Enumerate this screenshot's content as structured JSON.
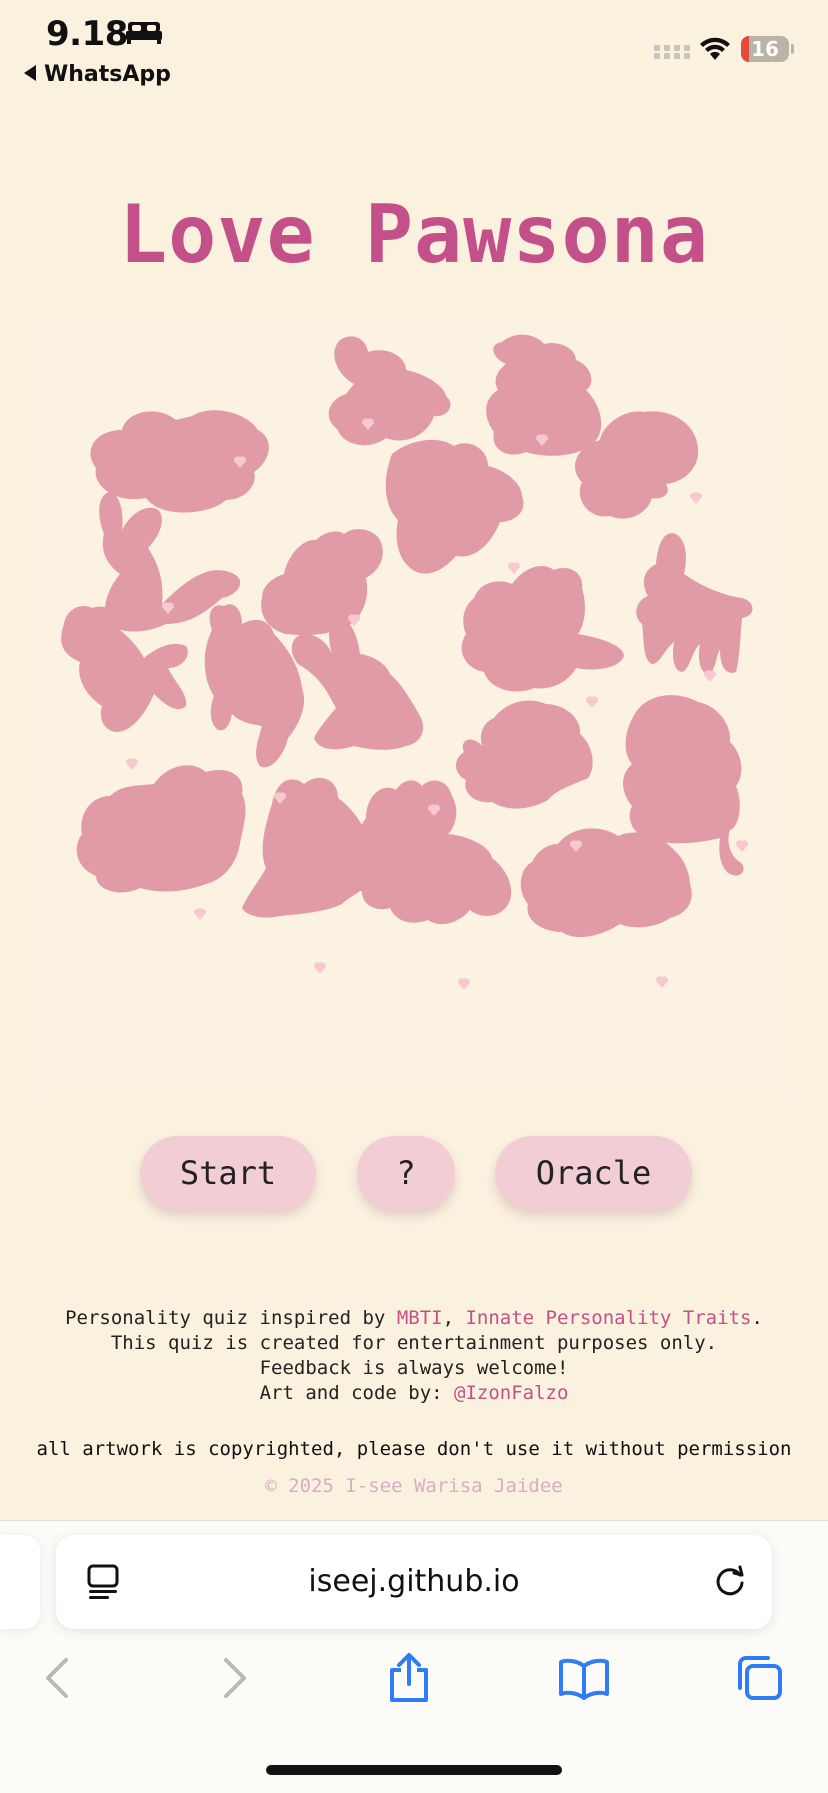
{
  "status_bar": {
    "time": "9.18",
    "back_app": "WhatsApp",
    "battery": "16",
    "battery_level": 0.16
  },
  "page": {
    "title": "Love Pawsona",
    "buttons": {
      "start": "Start",
      "help": "?",
      "oracle": "Oracle"
    },
    "footer": {
      "line1_prefix": "Personality quiz inspired by ",
      "link_mbti": "MBTI",
      "line1_sep": ", ",
      "link_traits": "Innate Personality Traits",
      "line1_end": ".",
      "line2": "This quiz is created for entertainment purposes only.",
      "line3": "Feedback is always welcome!",
      "line4_prefix": "Art and code by: ",
      "link_author": "@IzonFalzo"
    },
    "copyright_note": "all artwork is copyrighted, please don't use it without permission",
    "copyright": "© 2025 I-see Warisa Jaidee"
  },
  "browser": {
    "url": "iseej.github.io"
  },
  "colors": {
    "background": "#fbf1df",
    "accent": "#c4508a",
    "silhouette": "#e19ba6",
    "button": "#f3cdd5",
    "ios_blue": "#2f7cf6"
  },
  "icons": [
    "bed-icon",
    "back-arrow-icon",
    "cellular-signal-icon",
    "wifi-icon",
    "battery-icon",
    "reader-mode-icon",
    "reload-icon",
    "back-icon",
    "forward-icon",
    "share-icon",
    "bookmarks-icon",
    "tabs-icon"
  ]
}
